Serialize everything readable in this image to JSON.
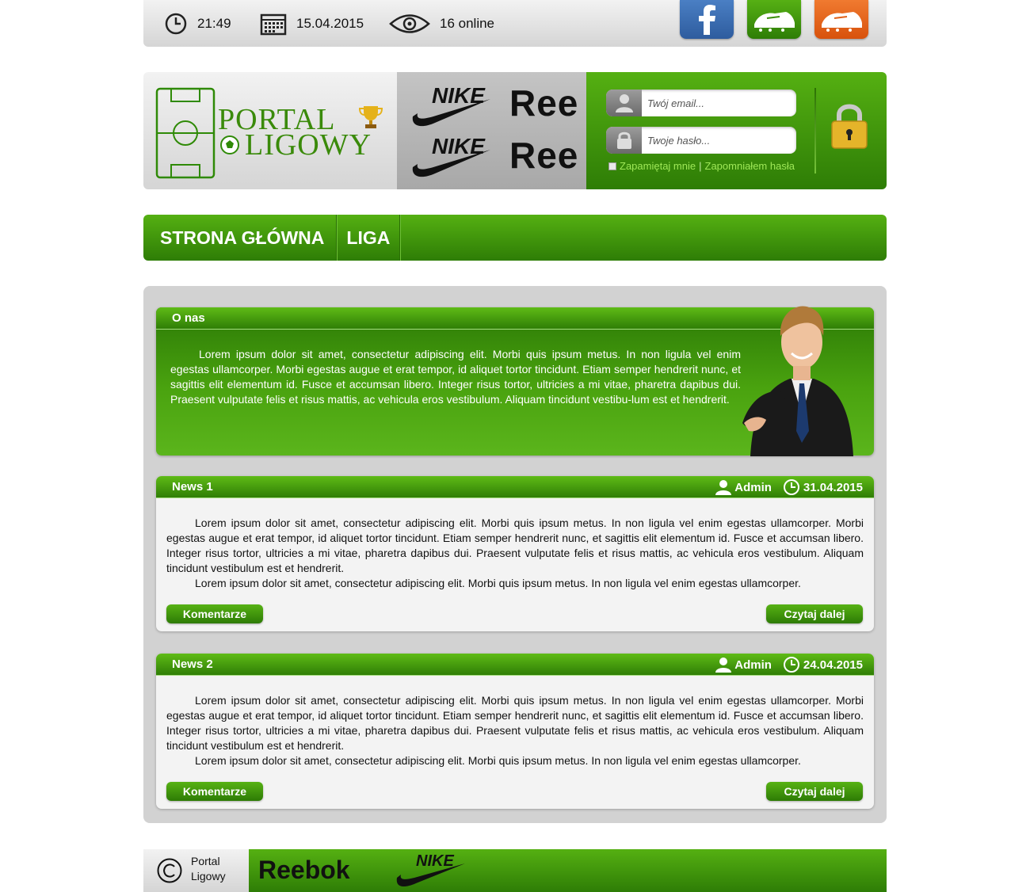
{
  "topbar": {
    "time": "21:49",
    "date": "15.04.2015",
    "online": "16 online",
    "social": [
      {
        "name": "facebook",
        "color": "#3b6bb0"
      },
      {
        "name": "green-boot",
        "color": "#3e9a0c"
      },
      {
        "name": "orange-boot",
        "color": "#e6621a"
      }
    ]
  },
  "logo": {
    "line1": "PORTAL",
    "line2": "LIGOWY"
  },
  "brands": {
    "nike": "NIKE",
    "reebok": "Ree"
  },
  "login": {
    "email_placeholder": "Twój email...",
    "password_placeholder": "Twoje hasło...",
    "remember": "Zapamiętaj mnie",
    "separator": "|",
    "forgot": "Zapomniałem hasła"
  },
  "nav": {
    "items": [
      "STRONA GŁÓWNA",
      "LIGA"
    ]
  },
  "about": {
    "title": "O nas",
    "text": "Lorem ipsum dolor sit amet, consectetur adipiscing elit. Morbi quis ipsum metus. In non ligula vel enim egestas ullamcorper. Morbi egestas augue et erat tempor, id aliquet tortor tincidunt. Etiam semper hendrerit nunc, et sagittis elit elementum id. Fusce et accumsan libero. Integer risus tortor, ultricies a mi vitae, pharetra dapibus dui. Praesent vulputate felis et risus mattis, ac vehicula eros vestibulum. Aliquam tincidunt vestibu-lum est et hendrerit."
  },
  "news": [
    {
      "title": "News 1",
      "author": "Admin",
      "date": "31.04.2015",
      "p1": "Lorem ipsum dolor sit amet, consectetur adipiscing elit. Morbi quis ipsum metus. In non ligula vel enim egestas ullamcorper. Morbi egestas augue et erat tempor, id aliquet tortor tincidunt. Etiam semper hendrerit nunc, et sagittis elit elementum id. Fusce et accumsan libero. Integer risus tortor, ultricies a mi vitae, pharetra dapibus dui. Praesent vulputate felis et risus mattis, ac vehicula eros vestibulum. Aliquam tincidunt vestibulum est et hendrerit.",
      "p2": "Lorem ipsum dolor sit amet, consectetur adipiscing elit. Morbi quis ipsum metus. In non ligula vel enim egestas ullamcorper.",
      "comments_label": "Komentarze",
      "read_more_label": "Czytaj dalej"
    },
    {
      "title": "News 2",
      "author": "Admin",
      "date": "24.04.2015",
      "p1": "Lorem ipsum dolor sit amet, consectetur adipiscing elit. Morbi quis ipsum metus. In non ligula vel enim egestas ullamcorper. Morbi egestas augue et erat tempor, id aliquet tortor tincidunt. Etiam semper hendrerit nunc, et sagittis elit elementum id. Fusce et accumsan libero. Integer risus tortor, ultricies a mi vitae, pharetra dapibus dui. Praesent vulputate felis et risus mattis, ac vehicula eros vestibulum. Aliquam tincidunt vestibulum est et hendrerit.",
      "p2": "Lorem ipsum dolor sit amet, consectetur adipiscing elit. Morbi quis ipsum metus. In non ligula vel enim egestas ullamcorper.",
      "comments_label": "Komentarze",
      "read_more_label": "Czytaj dalej"
    }
  ],
  "footer": {
    "copyright_line1": "Portal",
    "copyright_line2": "Ligowy",
    "brand1": "Reebok",
    "brand2": "NIKE"
  }
}
